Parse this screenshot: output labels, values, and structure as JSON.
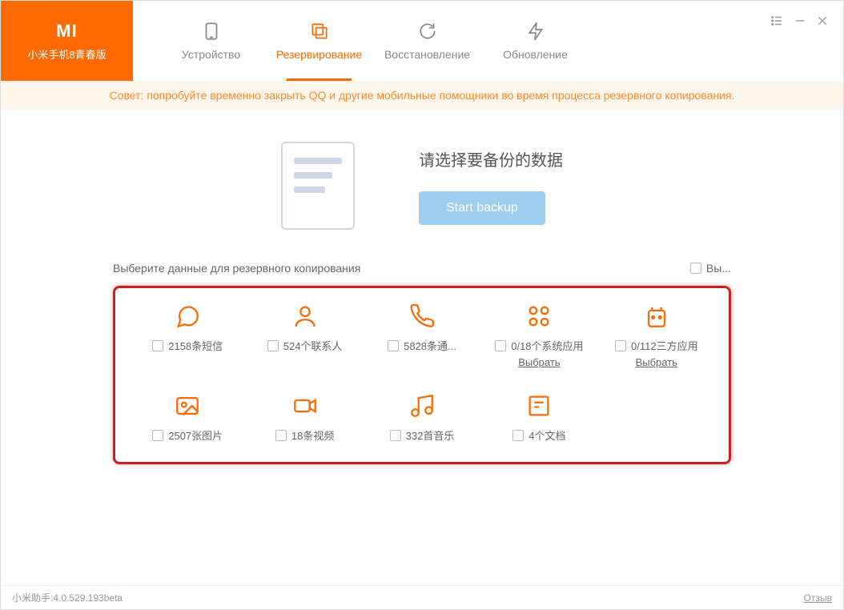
{
  "brand": {
    "logo": "MI",
    "device": "小米手机8青春版"
  },
  "tabs": {
    "device": "Устройство",
    "backup": "Резервирование",
    "restore": "Восстановление",
    "update": "Обновление"
  },
  "tip": "Совет: попробуйте временно закрыть QQ и другие мобильные помощники во время процесса резервного копирования.",
  "hero": {
    "title": "请选择要备份的数据",
    "button": "Start backup"
  },
  "select_label": "Выберите данные для резервного копирования",
  "select_all": "Вы...",
  "items": {
    "sms": {
      "label": "2158条短信"
    },
    "contacts": {
      "label": "524个联系人"
    },
    "calls": {
      "label": "5828条通..."
    },
    "sysapps": {
      "label": "0/18个系统应用",
      "select": "Выбрать"
    },
    "thirdapps": {
      "label": "0/112三方应用",
      "select": "Выбрать"
    },
    "photos": {
      "label": "2507张图片"
    },
    "videos": {
      "label": "18条视频"
    },
    "music": {
      "label": "332首音乐"
    },
    "docs": {
      "label": "4个文档"
    }
  },
  "footer": {
    "version": "小米助手:4.0.529.193beta",
    "feedback": "Отзыв"
  }
}
